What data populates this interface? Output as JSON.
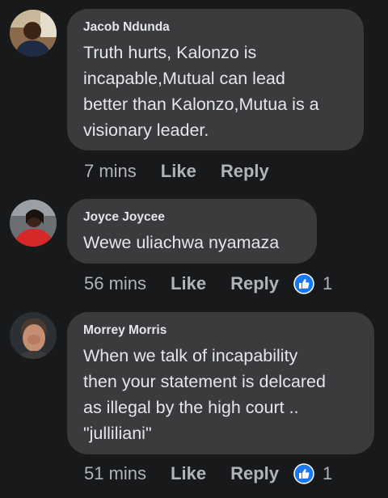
{
  "colors": {
    "background": "#18191a",
    "bubble": "#3a3b3c",
    "text_primary": "#e4e6eb",
    "text_secondary": "#b0b3b8",
    "like_blue": "#1877f2"
  },
  "comments": [
    {
      "author": "Jacob Ndunda",
      "lines": [
        "Truth hurts, Kalonzo is",
        "incapable,Mutual can lead",
        "better than Kalonzo,Mutua is a",
        "visionary leader."
      ],
      "time": "7 mins",
      "like_label": "Like",
      "reply_label": "Reply",
      "reaction_count": null
    },
    {
      "author": "Joyce Joycee",
      "lines": [
        "Wewe uliachwa nyamaza"
      ],
      "time": "56 mins",
      "like_label": "Like",
      "reply_label": "Reply",
      "reaction_icon": "thumbs-up-like-icon",
      "reaction_count": "1"
    },
    {
      "author": "Morrey Morris",
      "lines": [
        "When we talk of incapability",
        "then your statement is delcared",
        "as illegal by the high court ..",
        "\"julliliani\""
      ],
      "time": "51 mins",
      "like_label": "Like",
      "reply_label": "Reply",
      "reaction_icon": "thumbs-up-like-icon",
      "reaction_count": "1"
    }
  ]
}
